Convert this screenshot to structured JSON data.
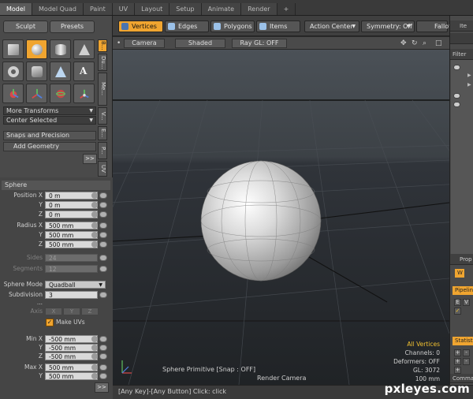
{
  "tabs": [
    {
      "label": "Model",
      "active": true
    },
    {
      "label": "Model Quad"
    },
    {
      "label": "Paint"
    },
    {
      "label": "UV"
    },
    {
      "label": "Layout"
    },
    {
      "label": "Setup"
    },
    {
      "label": "Animate"
    },
    {
      "label": "Render"
    },
    {
      "label": "+"
    }
  ],
  "left": {
    "sculpt_label": "Sculpt",
    "presets_label": "Presets",
    "tool_icons": [
      "cube-icon",
      "sphere-icon",
      "cylinder-icon",
      "cone-icon",
      "torus-icon",
      "capsule-icon",
      "teardrop-icon",
      "text-icon",
      "ellipsoid-icon",
      "gizmo-icon",
      "dome-icon",
      "tube-icon"
    ],
    "text_tool_glyph": "A",
    "more_transforms": "More Transforms",
    "center_selected": "Center Selected",
    "snaps": "Snaps and Precision",
    "add_geometry": "Add Geometry",
    "arrow_btn": ">>",
    "vtabs": [
      "B...",
      "Du...",
      "Me...",
      "V...",
      "E...",
      "P...",
      "UV"
    ]
  },
  "sphere": {
    "header": "Sphere",
    "position": {
      "label_x": "Position X",
      "label_y": "Y",
      "label_z": "Z",
      "x": "0 m",
      "y": "0 m",
      "z": "0 m"
    },
    "radius": {
      "label_x": "Radius X",
      "label_y": "Y",
      "label_z": "Z",
      "x": "500 mm",
      "y": "500 mm",
      "z": "500 mm"
    },
    "sides_label": "Sides",
    "sides": "24",
    "segments_label": "Segments",
    "segments": "12",
    "mode_label": "Sphere Mode",
    "mode": "Quadball",
    "subdiv_label": "Subdivision ...",
    "subdiv": "3",
    "axis_label": "Axis",
    "axis_options": [
      "X",
      "Y",
      "Z"
    ],
    "make_uvs_label": "Make UVs",
    "min": {
      "label_x": "Min X",
      "label_y": "Y",
      "label_z": "Z",
      "x": "-500 mm",
      "y": "-500 mm",
      "z": "-500 mm"
    },
    "max": {
      "label_x": "Max X",
      "label_y": "Y",
      "x": "500 mm",
      "y": "500 mm"
    },
    "bottom_arrow": ">>"
  },
  "modebar": {
    "vertices": "Vertices",
    "edges": "Edges",
    "polygons": "Polygons",
    "items": "Items",
    "action_center": "Action Center",
    "symmetry": "Symmetry: Off",
    "falloff": "Falloff"
  },
  "viewport_header": {
    "camera": "Camera",
    "shaded": "Shaded",
    "raygl": "Ray GL: OFF",
    "icons": [
      "move-view-icon",
      "rotate-view-icon",
      "zoom-view-icon",
      "maximize-view-icon"
    ]
  },
  "viewport_info": {
    "selection": "All Vertices",
    "channels": "Channels: 0",
    "deformers": "Deformers: OFF",
    "gl": "GL: 3072",
    "distance": "100 mm",
    "primitive": "Sphere Primitive  [Snap : OFF]",
    "render_camera": "Render Camera"
  },
  "status": "[Any Key]-[Any Button] Click:  click",
  "right": {
    "header": "Ite",
    "filter": "Filter",
    "props_tab": "Prop",
    "w_tab": "W",
    "pipeline": "Pipelin",
    "stats": "Statist",
    "command": "Comman",
    "cells": [
      "E",
      "V"
    ]
  },
  "watermark": "pxleyes.com",
  "colors": {
    "accent": "#f0a530",
    "viewport_bg": "#2a2d31",
    "info_yellow": "#f0c030"
  }
}
